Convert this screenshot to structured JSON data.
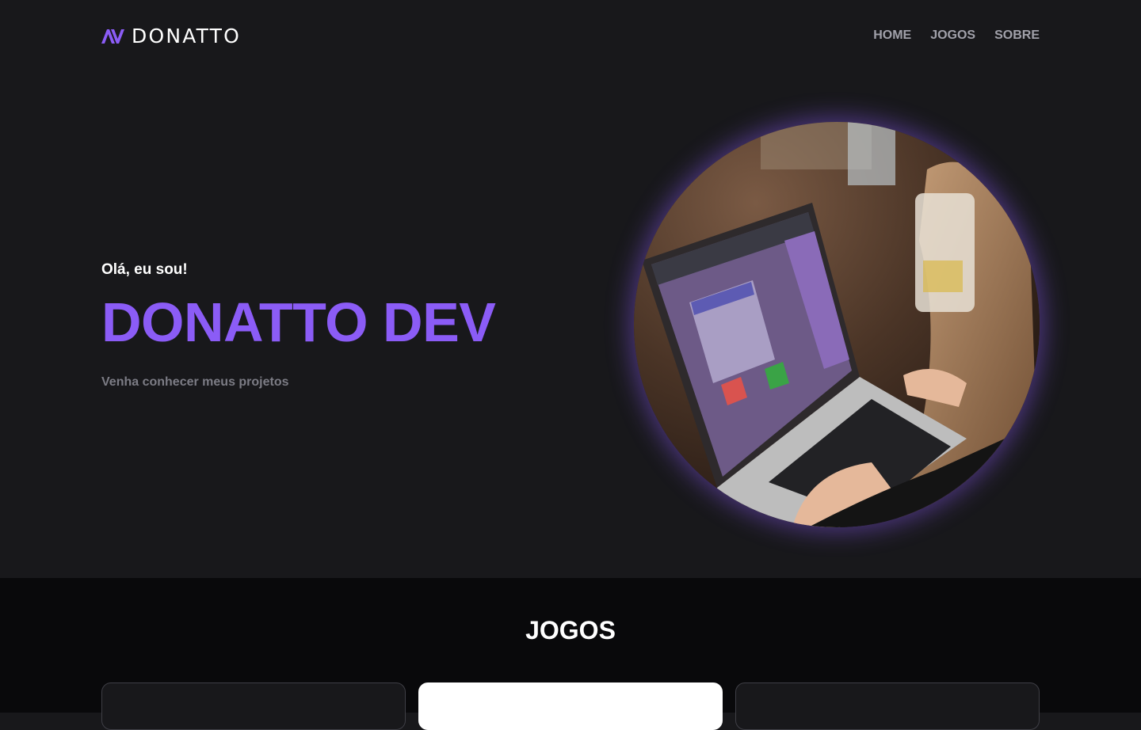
{
  "header": {
    "logo_text": "DONATTO",
    "nav": [
      "HOME",
      "JOGOS",
      "SOBRE"
    ]
  },
  "hero": {
    "greeting": "Olá, eu sou!",
    "name": "DONATTO DEV",
    "subtitle": "Venha conhecer meus projetos",
    "image": "photo of a person typing on a laptop showing a math game"
  },
  "games": {
    "title": "JOGOS",
    "cards": [
      "",
      "",
      ""
    ]
  },
  "colors": {
    "accent": "#8b5cf6",
    "background": "#18181b",
    "section_background": "#09090b",
    "nav_text": "#a1a1aa",
    "muted_text": "#7c7c85"
  }
}
